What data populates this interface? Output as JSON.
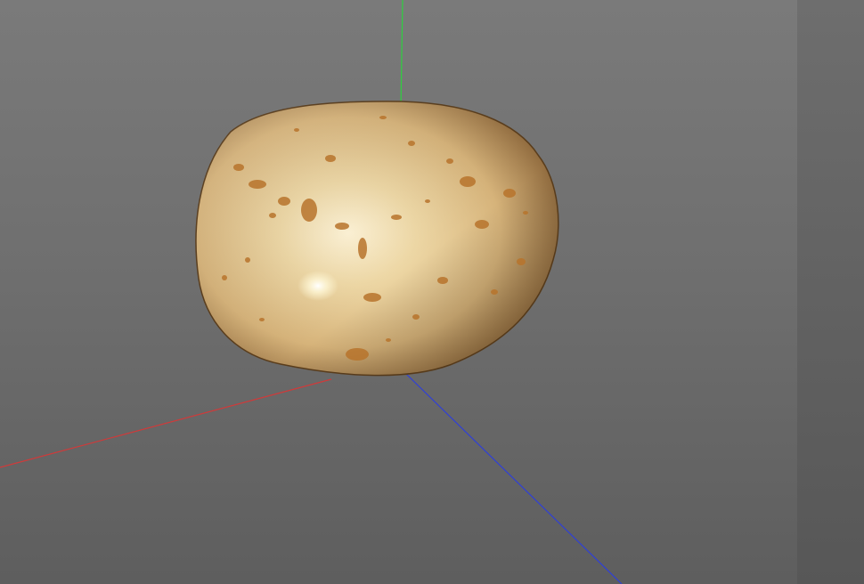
{
  "viewport": {
    "background_top": "#7a7a7a",
    "background_bottom": "#5e5e5e",
    "axes": {
      "x_color": "#d03a3a",
      "y_color": "#2ecf3f",
      "z_color": "#2f3fd8"
    },
    "model": {
      "name": "potato",
      "skin_color": "#e8cf9a",
      "spot_color": "#b8742c"
    }
  },
  "side_panel": {
    "background": "#626262"
  }
}
